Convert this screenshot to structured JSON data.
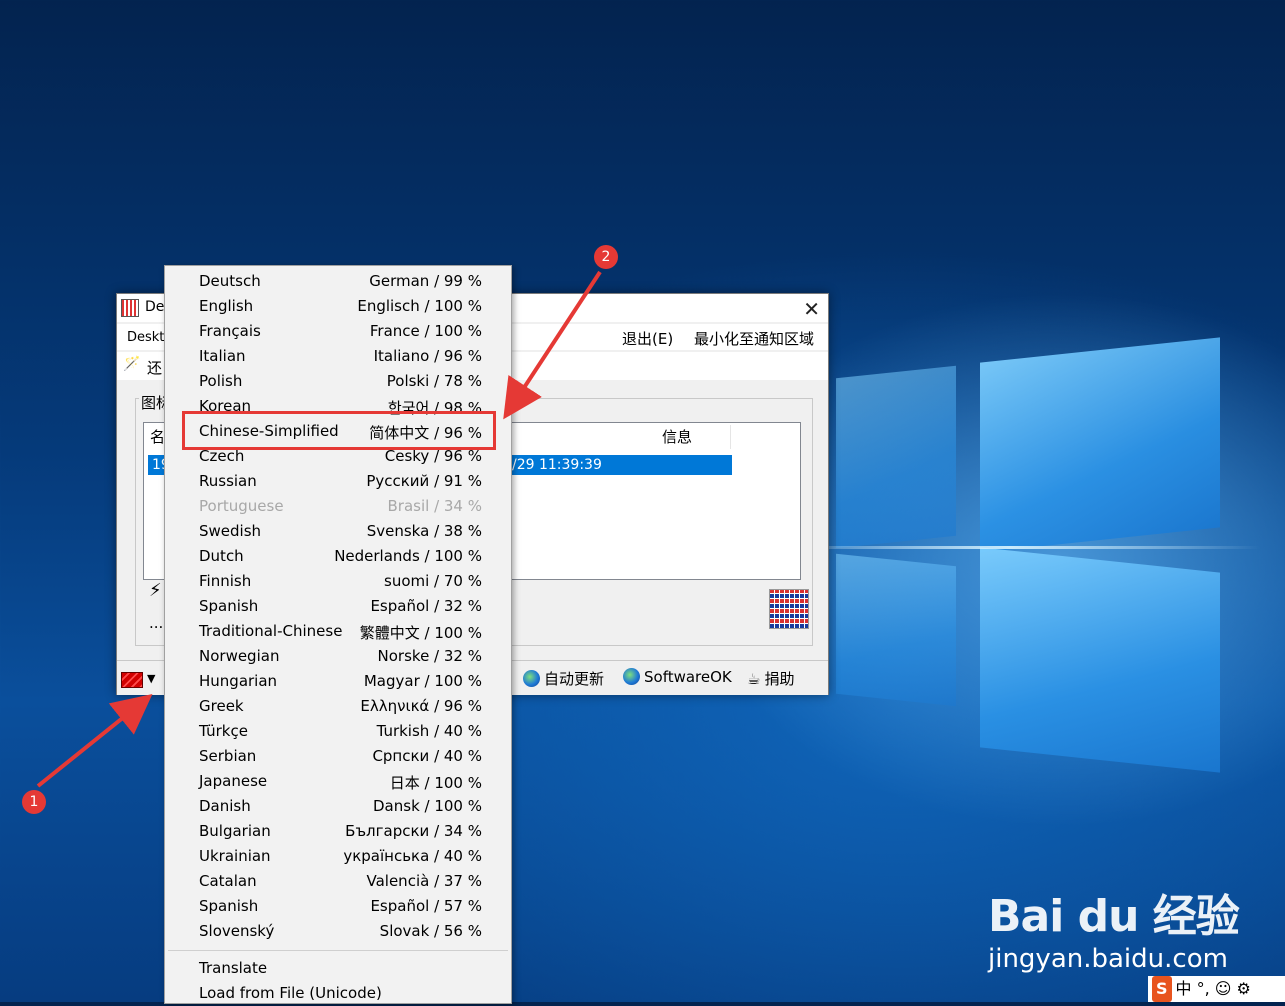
{
  "window": {
    "title": "De",
    "menu_first": "Deskt",
    "menu_exit": "退出(E)",
    "menu_tray": "最小化至通知区域",
    "toolbar_label": "还",
    "group_label": "图标",
    "list_col_name": "名",
    "list_col_info": "信息",
    "row_left": "19",
    "row_right": "/29 11:39:39",
    "dots": "...",
    "bottom": {
      "auto_update": "自动更新",
      "softwareok": "SoftwareOK",
      "donate": "捐助"
    }
  },
  "language_menu": {
    "items": [
      {
        "name": "Deutsch",
        "detail": "German / 99 %"
      },
      {
        "name": "English",
        "detail": "Englisch / 100 %"
      },
      {
        "name": "Français",
        "detail": "France / 100 %"
      },
      {
        "name": "Italian",
        "detail": "Italiano / 96 %"
      },
      {
        "name": "Polish",
        "detail": "Polski / 78 %"
      },
      {
        "name": "Korean",
        "detail": "한국어 / 98 %"
      },
      {
        "name": "Chinese-Simplified",
        "detail": "简体中文 / 96 %"
      },
      {
        "name": "Czech",
        "detail": "Cesky / 96 %"
      },
      {
        "name": "Russian",
        "detail": "Русский / 91 %"
      },
      {
        "name": "Portuguese",
        "detail": "Brasil / 34 %"
      },
      {
        "name": "Swedish",
        "detail": "Svenska / 38 %"
      },
      {
        "name": "Dutch",
        "detail": "Nederlands / 100 %"
      },
      {
        "name": "Finnish",
        "detail": "suomi / 70 %"
      },
      {
        "name": "Spanish",
        "detail": "Español / 32 %"
      },
      {
        "name": "Traditional-Chinese",
        "detail": "繁體中文 / 100 %"
      },
      {
        "name": "Norwegian",
        "detail": "Norske / 32 %"
      },
      {
        "name": "Hungarian",
        "detail": "Magyar / 100 %"
      },
      {
        "name": "Greek",
        "detail": "Ελληνικά / 96 %"
      },
      {
        "name": "Türkçe",
        "detail": "Turkish / 40 %"
      },
      {
        "name": "Serbian",
        "detail": "Српски / 40 %"
      },
      {
        "name": "Japanese",
        "detail": "日本 / 100 %"
      },
      {
        "name": "Danish",
        "detail": "Dansk / 100 %"
      },
      {
        "name": "Bulgarian",
        "detail": "Български / 34 %"
      },
      {
        "name": "Ukrainian",
        "detail": "українська / 40 %"
      },
      {
        "name": "Catalan",
        "detail": "Valencià / 37 %"
      },
      {
        "name": "Spanish",
        "detail": "Español / 57 %"
      },
      {
        "name": "Slovenský",
        "detail": "Slovak / 56 %"
      }
    ],
    "disabled_item": "Portuguese",
    "translate": "Translate",
    "load_from_file": "Load from File (Unicode)"
  },
  "annotations": {
    "badge_1": "1",
    "badge_2": "2",
    "color": "#e53935"
  },
  "watermark": {
    "logo": "Bai du 经验",
    "url": "jingyan.baidu.com",
    "ime_logo": "S",
    "ime_text": "中 °, ☺ ⚙"
  }
}
